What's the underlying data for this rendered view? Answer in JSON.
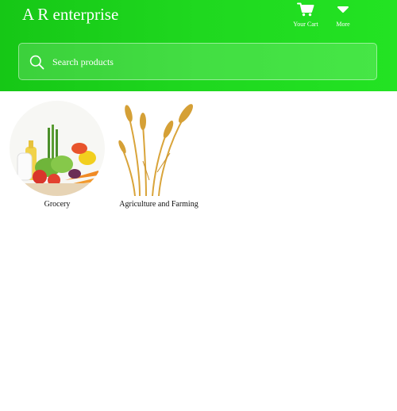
{
  "header": {
    "brand": "A R enterprise",
    "cart": {
      "label": "Your Cart",
      "icon": "cart-icon"
    },
    "more": {
      "label": "More",
      "icon": "chevron-down-icon"
    },
    "search": {
      "placeholder": "Search products",
      "value": "",
      "icon": "search-icon"
    }
  },
  "categories": [
    {
      "name": "Grocery",
      "icon": "grocery-basket-image"
    },
    {
      "name": "Agriculture and Farming",
      "icon": "wheat-image"
    }
  ],
  "colors": {
    "header_start": "#16c716",
    "header_end": "#23e323",
    "text_on_header": "#ffffff"
  }
}
